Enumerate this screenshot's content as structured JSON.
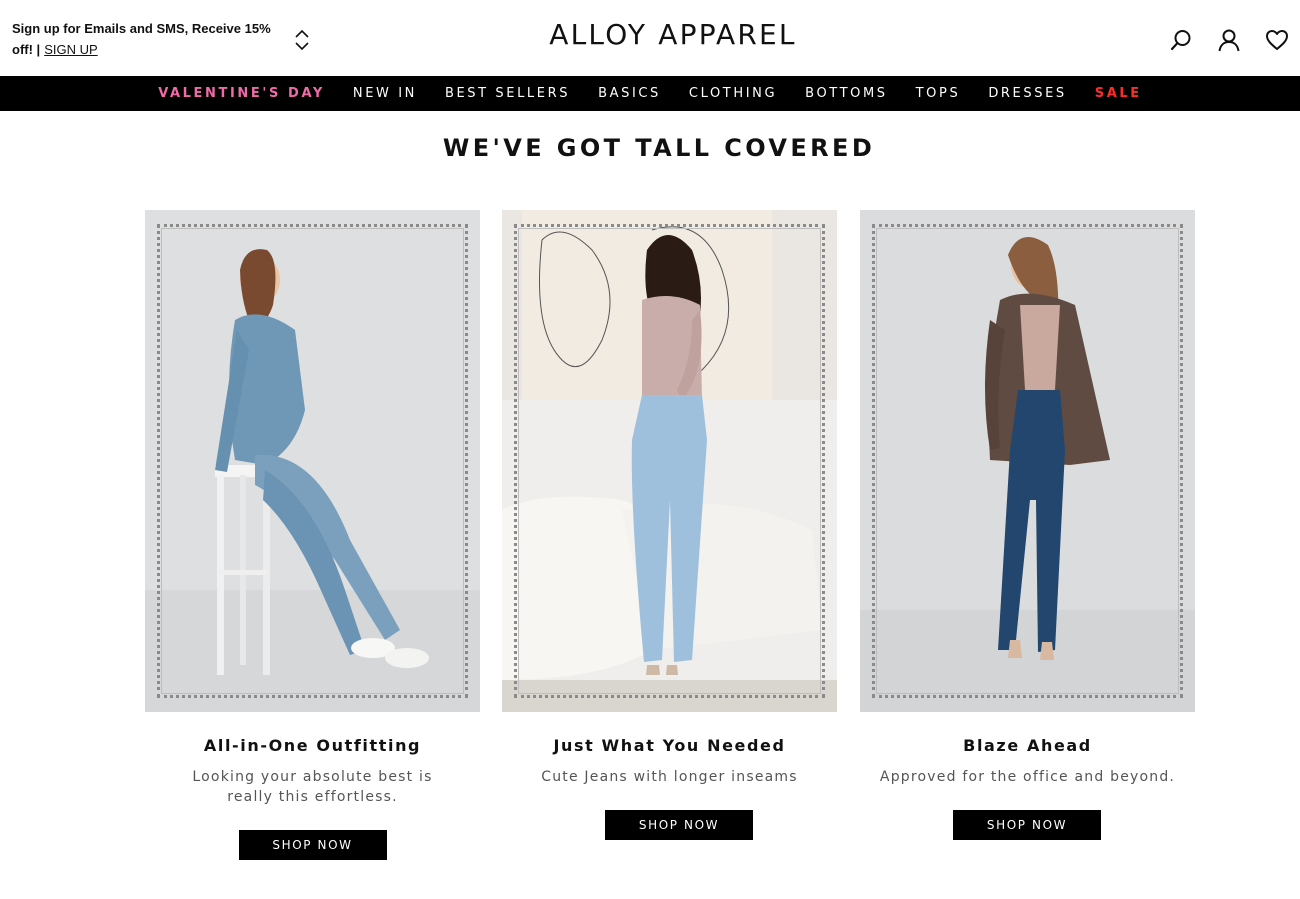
{
  "promo": {
    "text": "Sign up for Emails and SMS, Receive 15% off! |",
    "link": "SIGN UP"
  },
  "brand": {
    "logo": "ALLOY APPAREL"
  },
  "header_icons": [
    "search-icon",
    "account-icon",
    "wishlist-heart-icon"
  ],
  "nav": {
    "items": [
      {
        "label": "VALENTINE'S DAY",
        "style": "pink"
      },
      {
        "label": "NEW IN",
        "style": ""
      },
      {
        "label": "BEST SELLERS",
        "style": ""
      },
      {
        "label": "BASICS",
        "style": ""
      },
      {
        "label": "CLOTHING",
        "style": ""
      },
      {
        "label": "BOTTOMS",
        "style": ""
      },
      {
        "label": "TOPS",
        "style": ""
      },
      {
        "label": "DRESSES",
        "style": ""
      },
      {
        "label": "SALE",
        "style": "red"
      }
    ]
  },
  "section": {
    "title": "WE'VE GOT TALL COVERED"
  },
  "cards": [
    {
      "title": "All-in-One Outfitting",
      "description": "Looking your absolute best is really this effortless.",
      "button": "SHOP NOW",
      "image": "model in denim jumpsuit sitting on white stool"
    },
    {
      "title": "Just What You Needed",
      "description": "Cute Jeans with longer inseams",
      "button": "SHOP NOW",
      "image": "model in light wash jeans and mauve top"
    },
    {
      "title": "Blaze Ahead",
      "description": "Approved for the office and beyond.",
      "button": "SHOP NOW",
      "image": "model in brown blazer and flare jeans"
    }
  ],
  "colors": {
    "nav_bg": "#000000",
    "valentines": "#f06aa8",
    "sale": "#ff2b2b",
    "button_bg": "#000000"
  }
}
